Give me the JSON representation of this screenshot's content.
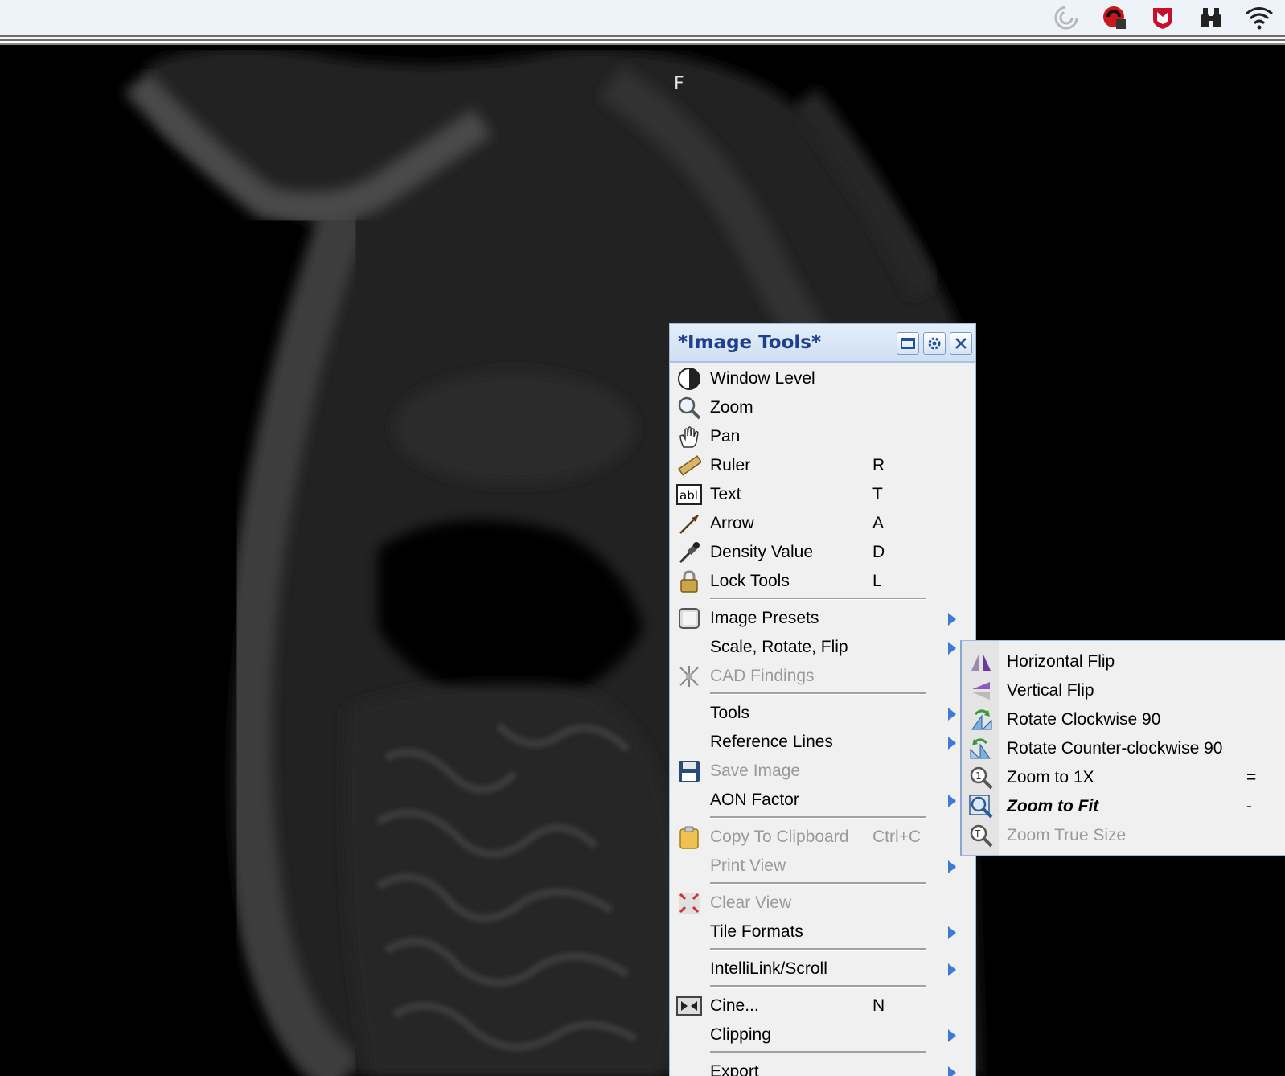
{
  "viewer": {
    "orientation_label": "F"
  },
  "tray_icons": [
    "spinner-icon",
    "red-shield-icon",
    "mcafee-icon",
    "binoculars-icon",
    "wifi-icon"
  ],
  "panel": {
    "title": "*Image Tools*",
    "controls": [
      "minimize-icon",
      "settings-icon",
      "close-icon"
    ]
  },
  "menu": {
    "items": [
      {
        "label": "Window Level",
        "shortcut": "",
        "icon": "window-level-icon"
      },
      {
        "label": "Zoom",
        "shortcut": "",
        "icon": "zoom-icon"
      },
      {
        "label": "Pan",
        "shortcut": "",
        "icon": "pan-hand-icon"
      },
      {
        "label": "Ruler",
        "shortcut": "R",
        "icon": "ruler-icon"
      },
      {
        "label": "Text",
        "shortcut": "T",
        "icon": "text-icon"
      },
      {
        "label": "Arrow",
        "shortcut": "A",
        "icon": "arrow-icon"
      },
      {
        "label": "Density Value",
        "shortcut": "D",
        "icon": "eyedropper-icon"
      },
      {
        "label": "Lock Tools",
        "shortcut": "L",
        "icon": "lock-icon"
      },
      {
        "label": "Image Presets",
        "shortcut": "",
        "icon": "image-presets-icon"
      },
      {
        "label": "Scale, Rotate, Flip",
        "shortcut": ""
      },
      {
        "label": "CAD Findings",
        "shortcut": "",
        "icon": "cad-icon",
        "disabled": true
      },
      {
        "label": "Tools",
        "shortcut": ""
      },
      {
        "label": "Reference Lines",
        "shortcut": ""
      },
      {
        "label": "Save Image",
        "shortcut": "",
        "icon": "floppy-disk-icon",
        "disabled": true
      },
      {
        "label": "AON Factor",
        "shortcut": ""
      },
      {
        "label": "Copy To Clipboard",
        "shortcut": "Ctrl+C",
        "icon": "clipboard-icon",
        "disabled": true
      },
      {
        "label": "Print View",
        "shortcut": "",
        "disabled": true
      },
      {
        "label": "Clear View",
        "shortcut": "",
        "icon": "clear-view-icon",
        "disabled": true
      },
      {
        "label": "Tile Formats",
        "shortcut": ""
      },
      {
        "label": "IntelliLink/Scroll",
        "shortcut": ""
      },
      {
        "label": "Cine...",
        "shortcut": "N",
        "icon": "cine-icon"
      },
      {
        "label": "Clipping",
        "shortcut": ""
      },
      {
        "label": "Export",
        "shortcut": ""
      }
    ]
  },
  "submenu": {
    "items": [
      {
        "label": "Horizontal Flip",
        "shortcut": "",
        "icon": "horizontal-flip-icon"
      },
      {
        "label": "Vertical Flip",
        "shortcut": "",
        "icon": "vertical-flip-icon"
      },
      {
        "label": "Rotate Clockwise 90",
        "shortcut": "",
        "icon": "rotate-clockwise-icon"
      },
      {
        "label": "Rotate Counter-clockwise 90",
        "shortcut": "",
        "icon": "rotate-counterclockwise-icon"
      },
      {
        "label": "Zoom to 1X",
        "shortcut": "=",
        "icon": "zoom-1x-icon"
      },
      {
        "label": "Zoom to Fit",
        "shortcut": "-",
        "icon": "zoom-fit-icon"
      },
      {
        "label": "Zoom True Size",
        "shortcut": "",
        "icon": "zoom-true-size-icon",
        "disabled": true
      }
    ]
  },
  "colors": {
    "accent": "#3d7ad6",
    "title_text": "#1f3f8f",
    "menu_bg": "#f0f0f0",
    "disabled_text": "#9a9a9a"
  }
}
